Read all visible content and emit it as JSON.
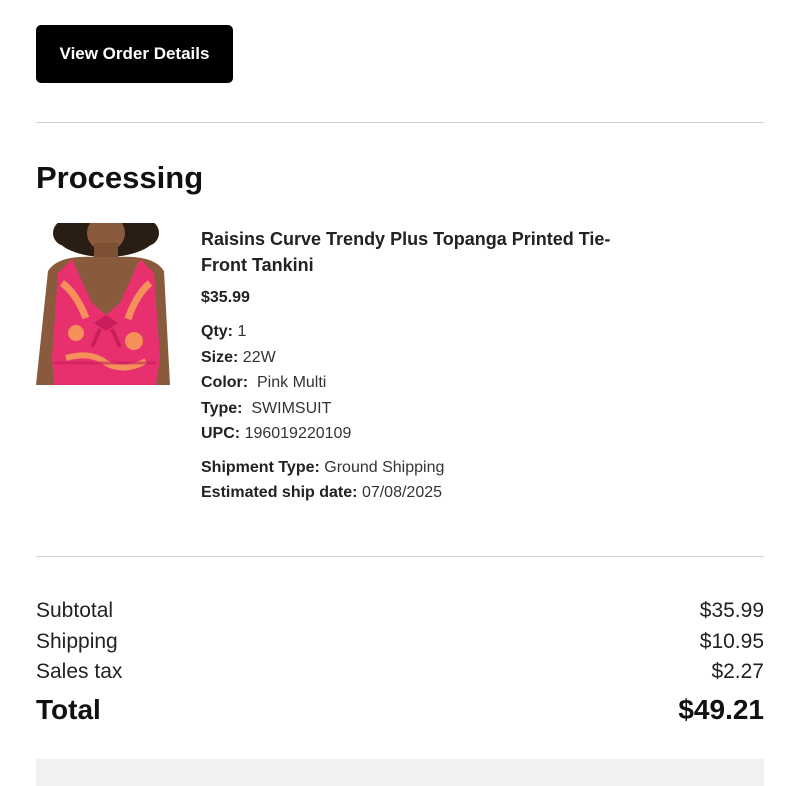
{
  "order": {
    "view_details_label": "View Order Details"
  },
  "shipment": {
    "status": "Processing",
    "item": {
      "name": "Raisins Curve Trendy Plus Topanga Printed Tie-Front Tankini",
      "price": "$35.99",
      "image_icon": "product-photo",
      "attributes": [
        {
          "label": "Qty:",
          "value": "1"
        },
        {
          "label": "Size:",
          "value": "22W"
        },
        {
          "label": "Color:",
          "value": "Pink Multi"
        },
        {
          "label": "Type:",
          "value": "SWIMSUIT"
        },
        {
          "label": "UPC:",
          "value": "196019220109"
        }
      ],
      "shipping": [
        {
          "label": "Shipment Type:",
          "value": "Ground Shipping"
        },
        {
          "label": "Estimated ship date:",
          "value": "07/08/2025"
        }
      ]
    }
  },
  "summary": {
    "subtotal_label": "Subtotal",
    "subtotal": "$35.99",
    "shipping_label": "Shipping",
    "shipping": "$10.95",
    "tax_label": "Sales tax",
    "tax": "$2.27",
    "total_label": "Total",
    "total": "$49.21"
  },
  "colors": {
    "button_bg": "#000000",
    "divider": "#cfcfcf",
    "swimsuit_pink": "#e8306f",
    "swimsuit_orange": "#f5905a"
  }
}
